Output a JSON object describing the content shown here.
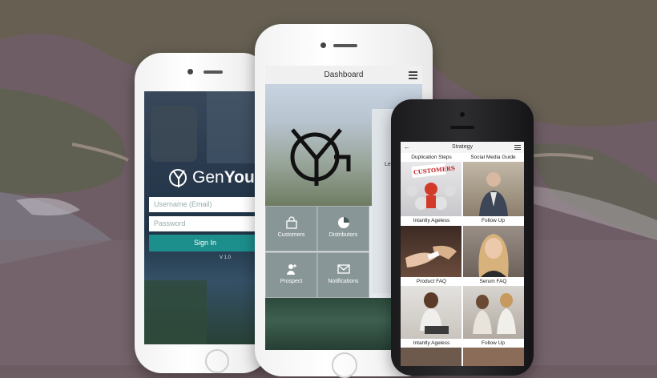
{
  "login": {
    "brand_pre": "Gen",
    "brand_bold": "You",
    "username_placeholder": "Username (Email)",
    "password_placeholder": "Password",
    "signin_label": "Sign In",
    "version": "V 1.0"
  },
  "dashboard": {
    "title": "Dashboard",
    "tiles": [
      {
        "label": "Customers",
        "icon": "shopping-bag-icon"
      },
      {
        "label": "Distributors",
        "icon": "pie-chart-icon"
      },
      {
        "label": "Prospect",
        "icon": "person-add-icon"
      },
      {
        "label": "Notifications",
        "icon": "envelope-icon"
      }
    ],
    "side_text": "Le"
  },
  "strategy": {
    "title": "Strategy",
    "back_glyph": "←",
    "items": [
      {
        "label": "Duplication Steps"
      },
      {
        "label": "Social Media Guide"
      },
      {
        "label": "Intantly Ageless"
      },
      {
        "label": "Follow Up"
      },
      {
        "label": "Product FAQ"
      },
      {
        "label": "Serum FAQ"
      },
      {
        "label": "Intantly Ageless"
      },
      {
        "label": "Follow Up"
      }
    ],
    "banner_text": "CUSTOMERS"
  },
  "colors": {
    "accent_teal": "#1c8e8c",
    "phone_white": "#f5f5f5",
    "phone_black": "#1e1e20"
  }
}
